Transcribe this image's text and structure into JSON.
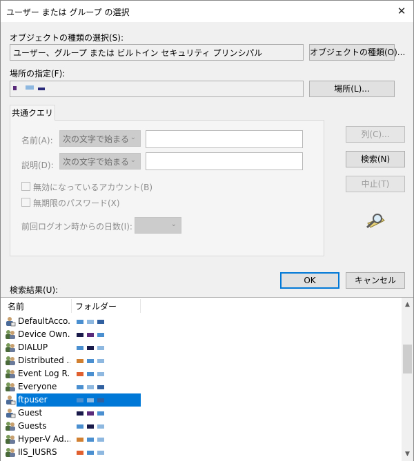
{
  "window": {
    "title": "ユーザー または グループ の選択",
    "close_glyph": "✕"
  },
  "object_types": {
    "label": "オブジェクトの種類の選択(S):",
    "value": "ユーザー、グループ または ビルトイン セキュリティ プリンシパル",
    "button": "オブジェクトの種類(O)..."
  },
  "location": {
    "label": "場所の指定(F):",
    "button": "場所(L)..."
  },
  "tab": {
    "label": "共通クエリ"
  },
  "query": {
    "name_label": "名前(A):",
    "name_combo": "次の文字で始まる",
    "desc_label": "説明(D):",
    "desc_combo": "次の文字で始まる",
    "disabled_accounts": "無効になっているアカウント(B)",
    "no_expire_pwd": "無期限のパスワード(X)",
    "days_since_logon": "前回ログオン時からの日数(I):"
  },
  "buttons": {
    "columns": "列(C)...",
    "search": "検索(N)",
    "stop": "中止(T)",
    "ok": "OK",
    "cancel": "キャンセル"
  },
  "results": {
    "label": "検索結果(U):",
    "col_name": "名前",
    "col_folder": "フォルダー",
    "rows": [
      {
        "name": "DefaultAcco...",
        "icon": "user-icon"
      },
      {
        "name": "Device Own...",
        "icon": "group-icon"
      },
      {
        "name": "DIALUP",
        "icon": "group-icon"
      },
      {
        "name": "Distributed ...",
        "icon": "group-icon"
      },
      {
        "name": "Event Log R...",
        "icon": "group-icon"
      },
      {
        "name": "Everyone",
        "icon": "group-icon"
      },
      {
        "name": "ftpuser",
        "icon": "user-icon"
      },
      {
        "name": "Guest",
        "icon": "user-icon"
      },
      {
        "name": "Guests",
        "icon": "group-icon"
      },
      {
        "name": "Hyper-V Ad...",
        "icon": "group-icon"
      },
      {
        "name": "IIS_IUSRS",
        "icon": "group-icon"
      }
    ]
  },
  "colors": {
    "accent": "#0078d7"
  }
}
